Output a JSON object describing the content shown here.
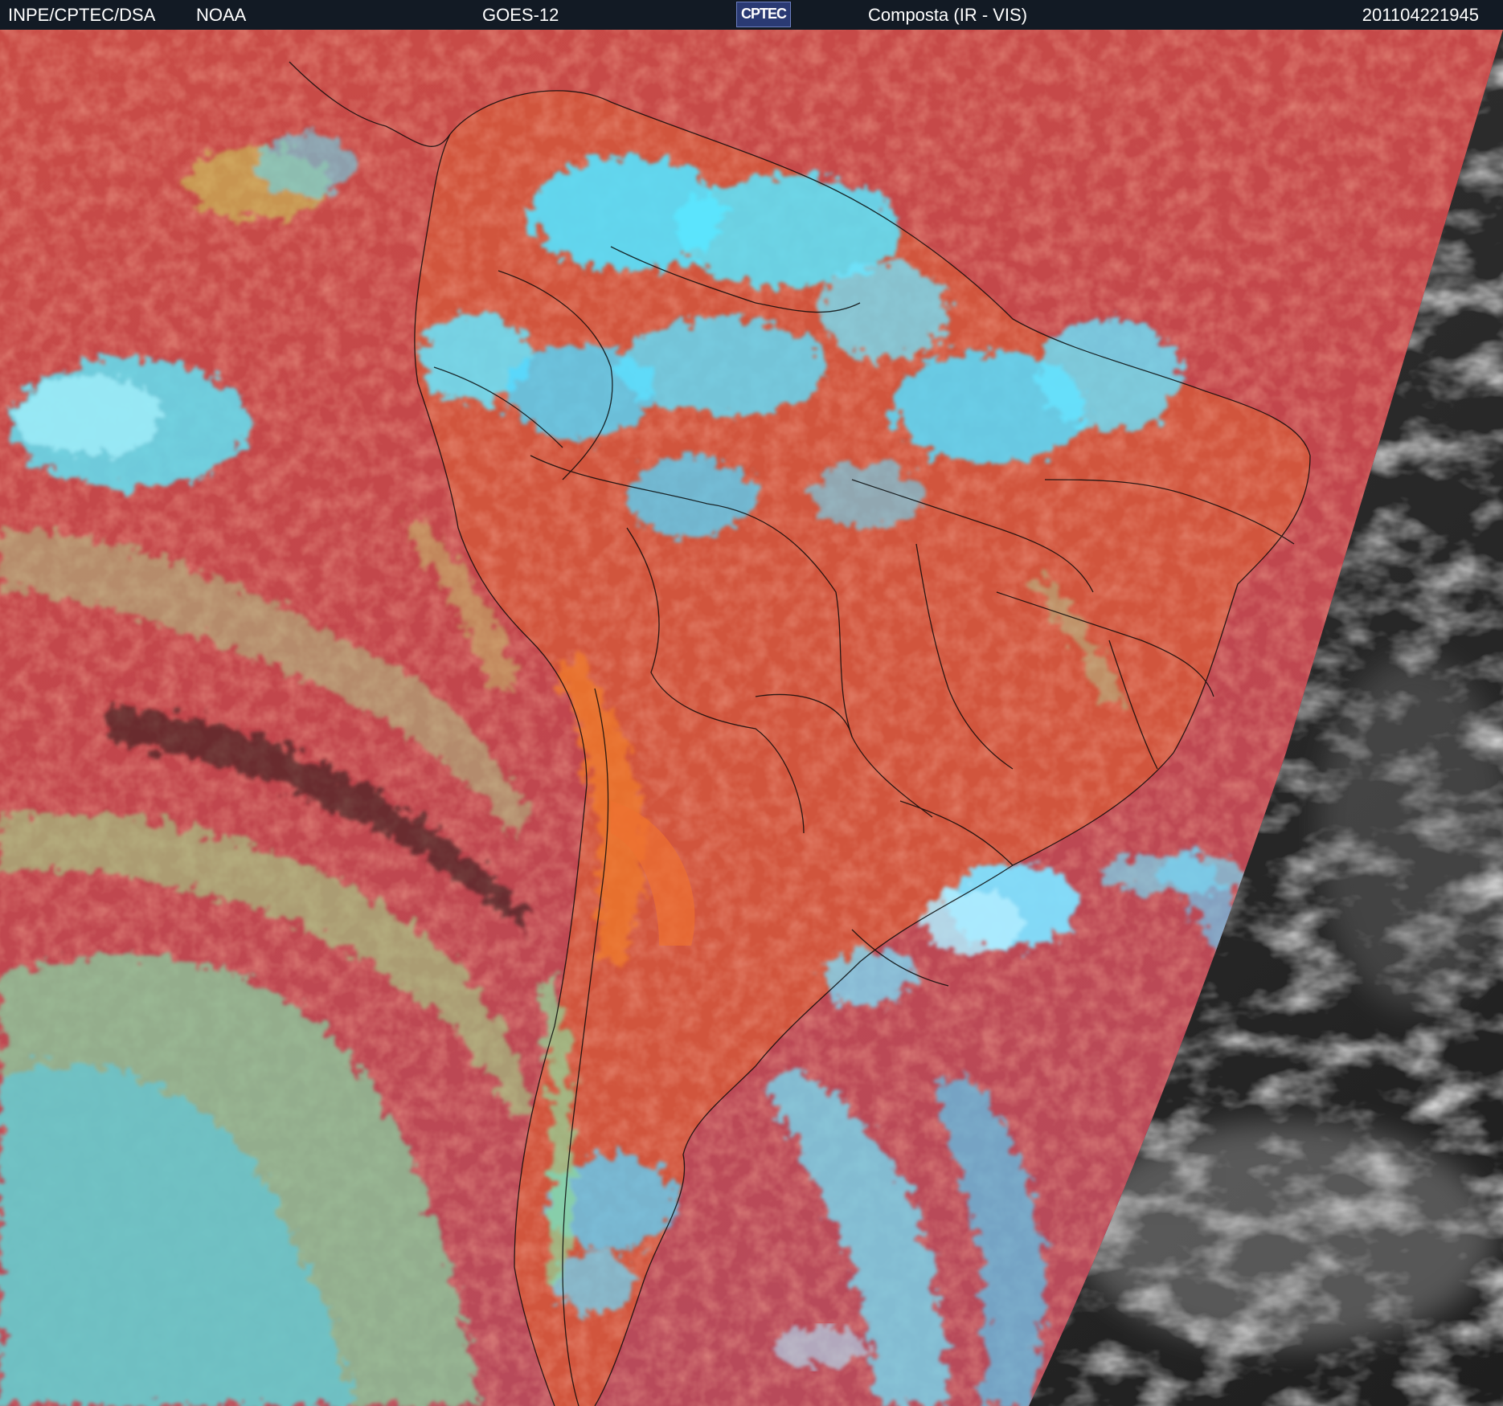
{
  "header": {
    "agency": "INPE/CPTEC/DSA",
    "partner": "NOAA",
    "satellite": "GOES-12",
    "logo_text": "CPTEC",
    "product": "Composta (IR - VIS)",
    "timestamp": "201104221945"
  },
  "colors": {
    "header_bg": "#121a24",
    "ocean_warm": "#c84a48",
    "land_warm": "#d5583a",
    "cold_cloud": "#58e4ff",
    "mid_cloud": "#8fdc8a",
    "night_side": "#2a2a2a",
    "borders": "#000000"
  }
}
